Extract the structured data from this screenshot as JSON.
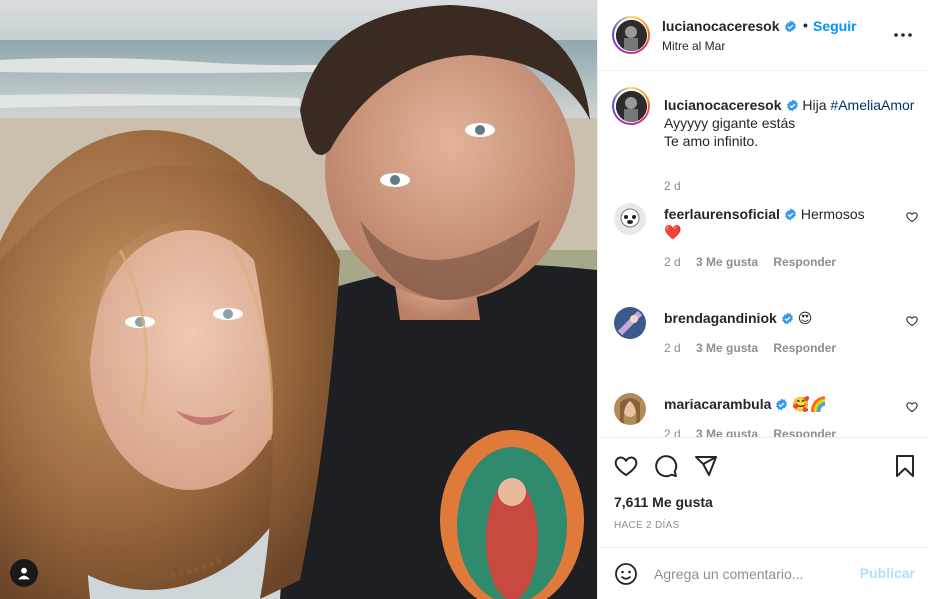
{
  "post": {
    "author": "lucianocaceresok",
    "follow_label": "Seguir",
    "separator": "•",
    "location": "Mitre al Mar"
  },
  "caption": {
    "username": "lucianocaceresok",
    "text_prefix": "Hija",
    "hashtag": "#AmeliaAmor",
    "line2": "Ayyyyy gigante estás",
    "line3": "Te amo infinito.",
    "time": "2 d"
  },
  "comments": [
    {
      "username": "feerlaurensoficial",
      "text": "Hermosos",
      "emoji": "❤️",
      "time": "2 d",
      "likes": "3 Me gusta",
      "reply": "Responder"
    },
    {
      "username": "brendagandiniok",
      "text": "",
      "emoji": "😍",
      "time": "2 d",
      "likes": "3 Me gusta",
      "reply": "Responder"
    },
    {
      "username": "mariacarambula",
      "text": "",
      "emoji": "🥰🌈",
      "time": "2 d",
      "likes": "3 Me gusta",
      "reply": "Responder"
    }
  ],
  "stats": {
    "likes": "7,611 Me gusta",
    "ago": "HACE 2 DÍAS"
  },
  "add_comment": {
    "placeholder": "Agrega un comentario...",
    "post_label": "Publicar"
  },
  "colors": {
    "accent": "#0095f6",
    "verified": "#3897f0",
    "text": "#262626",
    "muted": "#8e8e8e"
  },
  "icons": [
    "user-tag-icon",
    "verified-icon",
    "more-icon",
    "heart-icon",
    "comment-icon",
    "share-icon",
    "bookmark-icon",
    "emoji-icon"
  ]
}
